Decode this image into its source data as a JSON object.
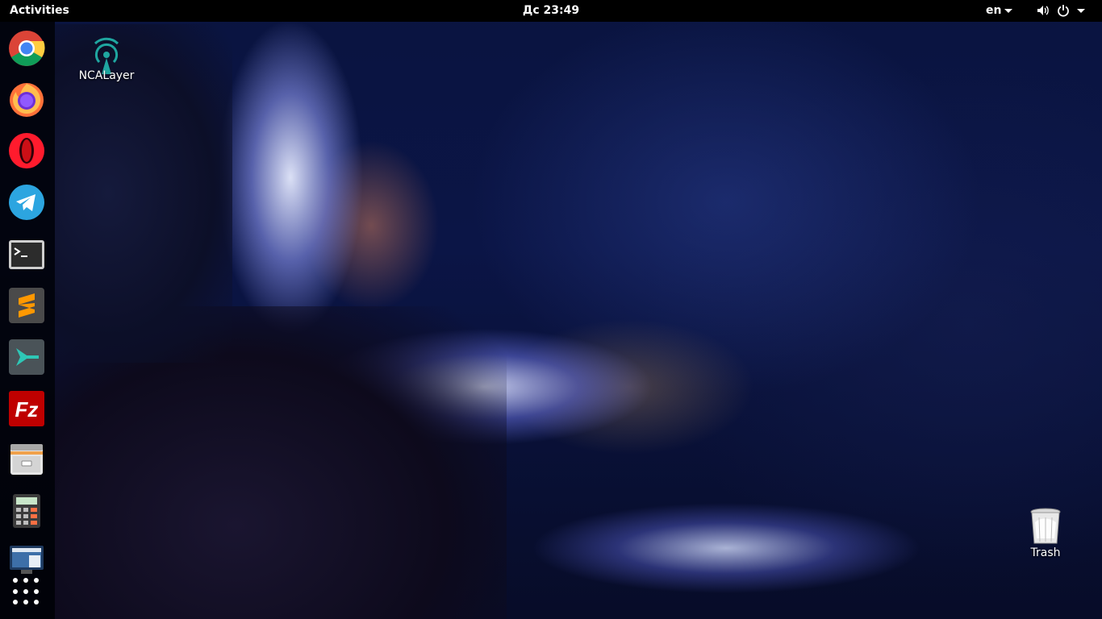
{
  "topbar": {
    "activities_label": "Activities",
    "clock": "Дс 23:49",
    "language": "en"
  },
  "dock": {
    "apps": [
      {
        "name": "Google Chrome",
        "icon": "chrome-icon"
      },
      {
        "name": "Firefox",
        "icon": "firefox-icon"
      },
      {
        "name": "Opera",
        "icon": "opera-icon"
      },
      {
        "name": "Telegram",
        "icon": "telegram-icon"
      },
      {
        "name": "Terminal",
        "icon": "terminal-icon"
      },
      {
        "name": "Sublime Text",
        "icon": "sublime-text-icon"
      },
      {
        "name": "Remote Desktop",
        "icon": "remmina-icon"
      },
      {
        "name": "FileZilla",
        "icon": "filezilla-icon"
      },
      {
        "name": "Files",
        "icon": "files-icon"
      },
      {
        "name": "Calculator",
        "icon": "calculator-icon"
      },
      {
        "name": "System Monitor",
        "icon": "screen-icon"
      }
    ],
    "show_apps": "grid-icon"
  },
  "desktop": {
    "ncalayer_label": "NCALayer",
    "trash_label": "Trash"
  },
  "colors": {
    "topbar_bg": "#000000",
    "dock_bg": "rgba(0,0,0,0.78)",
    "wallpaper_glow": "#c8ccff"
  }
}
